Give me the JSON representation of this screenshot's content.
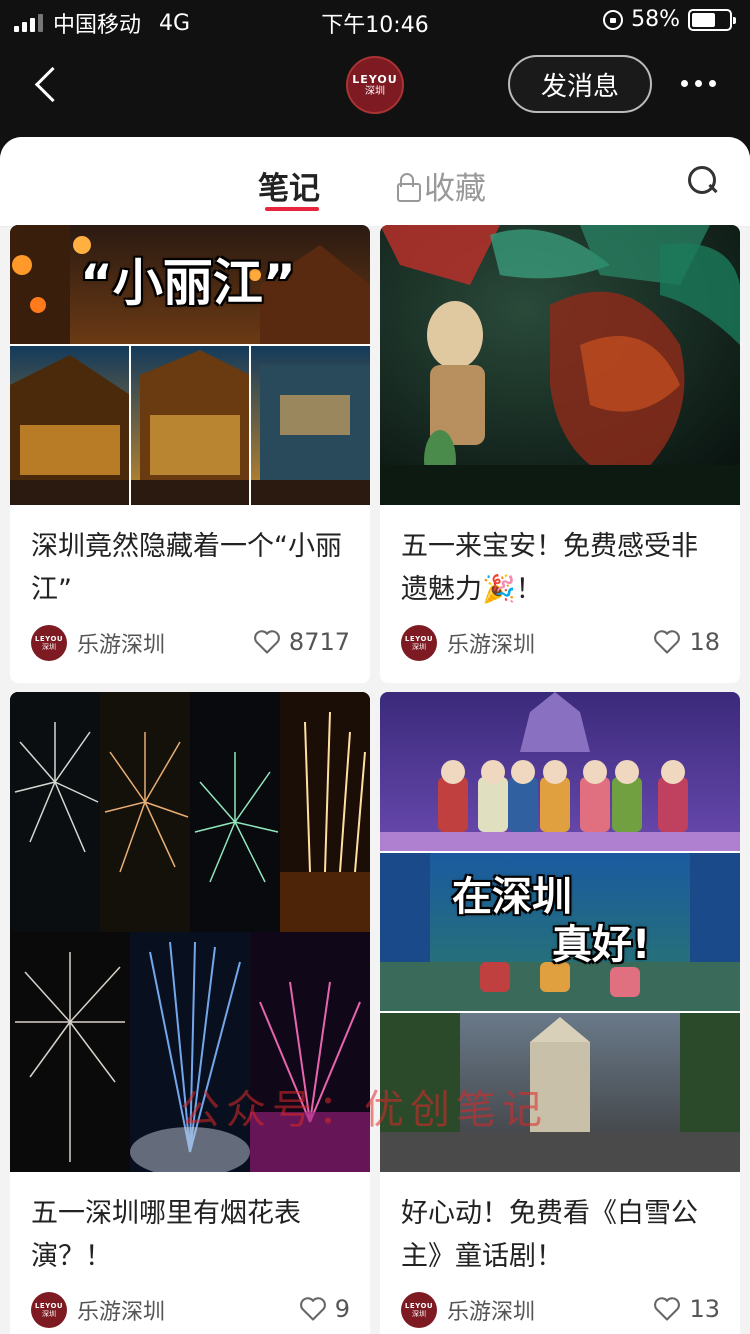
{
  "status_bar": {
    "carrier": "中国移动",
    "network": "4G",
    "time": "下午10:46",
    "battery_pct": "58%",
    "battery_level": 0.58
  },
  "nav": {
    "logo_line1": "LEYOU",
    "logo_line2": "深圳",
    "message_button": "发消息"
  },
  "tabs": {
    "notes": "笔记",
    "favorites": "收藏"
  },
  "cards": [
    {
      "title": "深圳竟然隐藏着一个“小丽江”",
      "image_text": "“小丽江”",
      "author": "乐游深圳",
      "likes": "8717"
    },
    {
      "title": "五一来宝安！免费感受非遗魅力🎉！",
      "author": "乐游深圳",
      "likes": "18"
    },
    {
      "title": "五一深圳哪里有烟花表演？！",
      "author": "乐游深圳",
      "likes": "9"
    },
    {
      "title": "好心动！免费看《白雪公主》童话剧！",
      "image_text_1": "在深圳",
      "image_text_2": "真好!",
      "author": "乐游深圳",
      "likes": "13"
    }
  ],
  "mini_logo": {
    "line1": "LEYOU",
    "line2": "深圳"
  },
  "watermark": "公众号：优创笔记",
  "colors": {
    "accent": "#e8243c",
    "brand": "#7d1a22",
    "topbar": "#111111"
  }
}
